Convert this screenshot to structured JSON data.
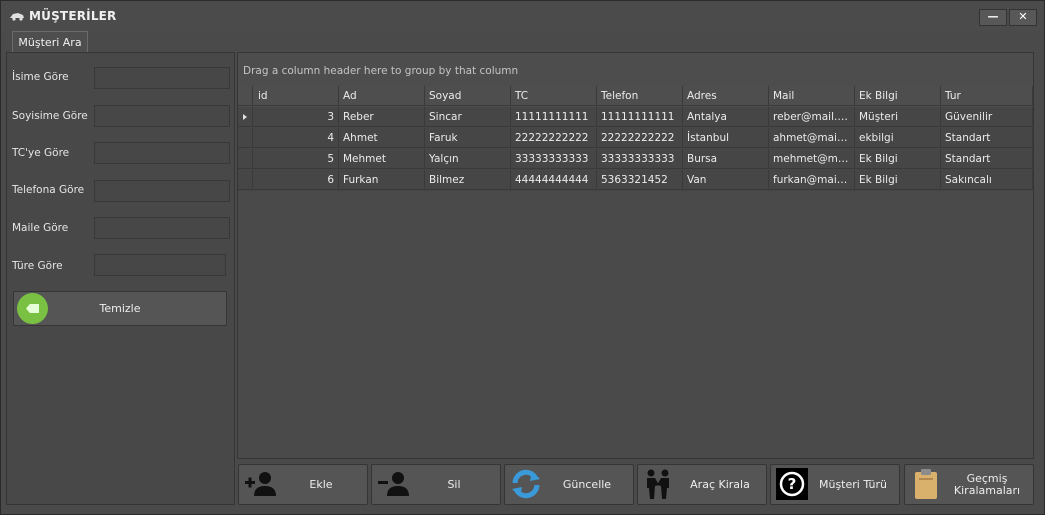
{
  "window": {
    "title": "MÜŞTERİLER",
    "minimize_glyph": "—",
    "close_glyph": "✕"
  },
  "tab": {
    "label": "Müşteri Ara"
  },
  "filters": [
    {
      "label": "İsime Göre",
      "value": ""
    },
    {
      "label": "Soyisime Göre",
      "value": ""
    },
    {
      "label": "TC'ye Göre",
      "value": ""
    },
    {
      "label": "Telefona Göre",
      "value": ""
    },
    {
      "label": "Maile Göre",
      "value": ""
    },
    {
      "label": "Türe Göre",
      "value": ""
    }
  ],
  "clear_button": {
    "label": "Temizle",
    "icon": "backspace-icon"
  },
  "grid": {
    "group_hint": "Drag a column header here to group by that column",
    "columns": [
      "id",
      "Ad",
      "Soyad",
      "TC",
      "Telefon",
      "Adres",
      "Mail",
      "Ek Bilgi",
      "Tur"
    ],
    "rows": [
      [
        "3",
        "Reber",
        "Sincar",
        "11111111111",
        "11111111111",
        "Antalya",
        "reber@mail.com",
        "Müşteri",
        "Güvenilir"
      ],
      [
        "4",
        "Ahmet",
        "Faruk",
        "22222222222",
        "22222222222",
        "İstanbul",
        "ahmet@mail.com",
        "ekbilgi",
        "Standart"
      ],
      [
        "5",
        "Mehmet",
        "Yalçın",
        "33333333333",
        "33333333333",
        "Bursa",
        "mehmet@mail.com",
        "Ek Bilgi",
        "Standart"
      ],
      [
        "6",
        "Furkan",
        "Bilmez",
        "44444444444",
        "5363321452",
        "Van",
        "furkan@mail.com",
        "Ek Bilgi",
        "Sakıncalı"
      ]
    ]
  },
  "actions": [
    {
      "label": "Ekle",
      "icon": "add-user-icon"
    },
    {
      "label": "Sil",
      "icon": "remove-user-icon"
    },
    {
      "label": "Güncelle",
      "icon": "refresh-icon"
    },
    {
      "label": "Araç Kirala",
      "icon": "handshake-icon"
    },
    {
      "label": "Müşteri Türü",
      "icon": "question-icon"
    },
    {
      "label": "Geçmiş Kiralamaları",
      "icon": "clipboard-icon"
    }
  ]
}
